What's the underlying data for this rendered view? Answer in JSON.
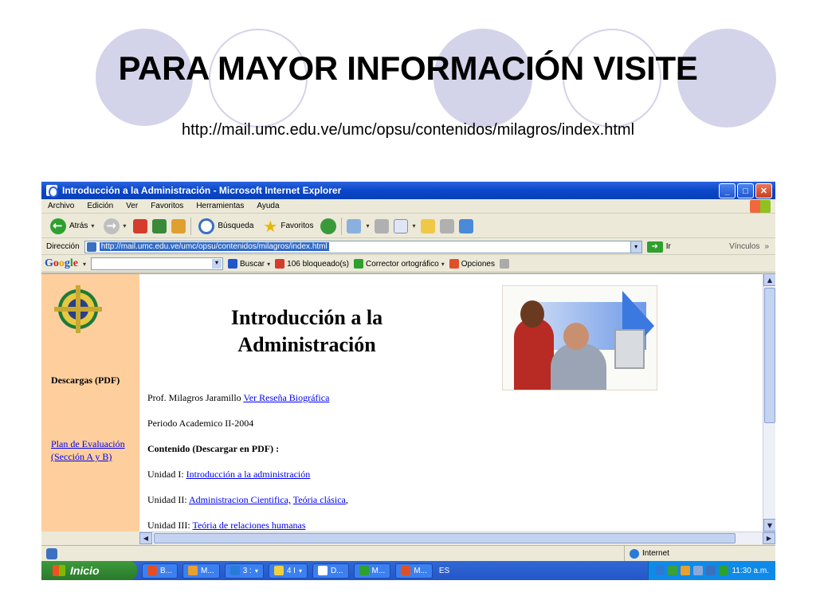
{
  "slide": {
    "title": "PARA MAYOR INFORMACIÓN VISITE",
    "url": "http://mail.umc.edu.ve/umc/opsu/contenidos/milagros/index.html"
  },
  "window": {
    "title": "Introducción a la Administración - Microsoft Internet Explorer",
    "buttons": {
      "minimize": "_",
      "maximize": "□",
      "close": "✕"
    }
  },
  "menu": [
    "Archivo",
    "Edición",
    "Ver",
    "Favoritos",
    "Herramientas",
    "Ayuda"
  ],
  "toolbar": {
    "back": "Atrás",
    "search": "Búsqueda",
    "favorites": "Favoritos"
  },
  "address": {
    "label": "Dirección",
    "value": "http://mail.umc.edu.ve/umc/opsu/contenidos/milagros/index.html",
    "go": "Ir",
    "links": "Vínculos",
    "more": "»"
  },
  "google_bar": {
    "logo": [
      "G",
      "o",
      "o",
      "g",
      "l",
      "e"
    ],
    "search": "Buscar",
    "blocked": "106 bloqueado(s)",
    "spell": "Corrector ortográfico",
    "options": "Opciones"
  },
  "sidebar": {
    "downloads": "Descargas (PDF)",
    "plan_link": "Plan de Evaluación (Sección A y B)"
  },
  "page": {
    "title": "Introducción a la Administración",
    "prof_label": "Prof. Milagros Jaramillo",
    "prof_link": "Ver Reseña Biográfica",
    "period": "Periodo Academico II-2004",
    "contents_heading": "Contenido (Descargar en PDF) :",
    "units": [
      {
        "label": "Unidad I:",
        "links": [
          "Introducción a la administración"
        ]
      },
      {
        "label": "Unidad II:",
        "links": [
          "Administracion Cientifica,",
          "Teória clásica"
        ],
        "suffix": ","
      },
      {
        "label": "Unidad III:",
        "links": [
          "Teória de relaciones humanas"
        ]
      }
    ]
  },
  "statusbar": {
    "zone": "Internet"
  },
  "taskbar": {
    "start": "Inicio",
    "tasks": [
      "B...",
      "M...",
      "3 :",
      "4 I",
      "D...",
      "M...",
      "M..."
    ],
    "lang": "ES",
    "clock": "11:30 a.m."
  },
  "colors": {
    "circle": "#d3d3ea",
    "sidebar_bg": "#fecf9d",
    "link": "#0000ee",
    "xp_blue": "#2456c8"
  }
}
